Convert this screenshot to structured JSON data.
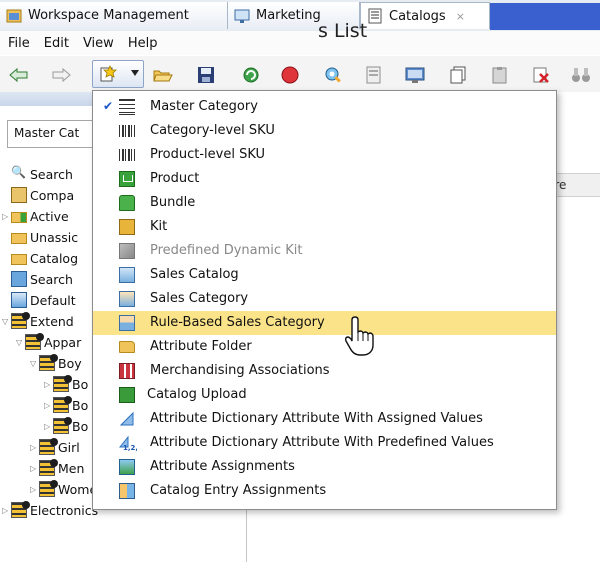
{
  "tabs": [
    {
      "label": "Workspace Management",
      "icon": "workspace-icon",
      "active": false
    },
    {
      "label": "Marketing",
      "icon": "marketing-icon",
      "active": false
    },
    {
      "label": "Catalogs",
      "icon": "catalogs-icon",
      "active": true,
      "close": "⨯"
    }
  ],
  "menubar": [
    "File",
    "Edit",
    "View",
    "Help"
  ],
  "toolbar": {
    "icons": [
      "back-arrow-icon",
      "forward-arrow-icon",
      "new-dropdown-icon",
      "open-folder-icon",
      "save-icon",
      "refresh-icon",
      "stop-icon",
      "find-icon",
      "template-icon",
      "monitor-icon",
      "copy-icon",
      "paste-icon",
      "delete-icon",
      "binoculars-icon"
    ]
  },
  "left_panel": {
    "combo_value": "Master Cat",
    "tree": [
      {
        "label": "Search",
        "icon": "search-icon"
      },
      {
        "label": "Compa",
        "icon": "company-icon"
      },
      {
        "label": "Active",
        "icon": "folder-icon"
      },
      {
        "label": "Unassic",
        "icon": "folder-icon"
      },
      {
        "label": "Catalog",
        "icon": "folder-icon"
      },
      {
        "label": "Search",
        "icon": "search-catalog-icon"
      },
      {
        "label": "Default",
        "icon": "default-icon"
      },
      {
        "label": "Extend",
        "icon": "category-icon"
      },
      {
        "label": "Appar",
        "icon": "category-icon"
      },
      {
        "label": "Boy",
        "icon": "category-icon"
      },
      {
        "label": "Bo",
        "icon": "category-icon"
      },
      {
        "label": "Bo",
        "icon": "category-icon"
      },
      {
        "label": "Bo",
        "icon": "category-icon"
      },
      {
        "label": "Girl",
        "icon": "category-icon"
      },
      {
        "label": "Men",
        "icon": "category-icon"
      },
      {
        "label": "Women",
        "icon": "category-icon"
      },
      {
        "label": "Electronics",
        "icon": "category-icon"
      }
    ]
  },
  "right_panel": {
    "title_fragment": "s List",
    "column_fragment": "ore"
  },
  "new_menu": {
    "items": [
      {
        "label": "Master Category",
        "icon": "master-category-icon",
        "checked": true
      },
      {
        "label": "Category-level SKU",
        "icon": "barcode-icon"
      },
      {
        "label": "Product-level SKU",
        "icon": "barcode-icon"
      },
      {
        "label": "Product",
        "icon": "product-icon"
      },
      {
        "label": "Bundle",
        "icon": "bundle-icon"
      },
      {
        "label": "Kit",
        "icon": "kit-icon"
      },
      {
        "label": "Predefined Dynamic Kit",
        "icon": "dynamic-kit-icon",
        "disabled": true
      },
      {
        "label": "Sales Catalog",
        "icon": "sales-catalog-icon"
      },
      {
        "label": "Sales Category",
        "icon": "sales-category-icon"
      },
      {
        "label": "Rule-Based Sales Category",
        "icon": "rule-based-category-icon",
        "highlighted": true
      },
      {
        "label": "Attribute Folder",
        "icon": "folder-icon"
      },
      {
        "label": "Merchandising Associations",
        "icon": "merchandising-icon"
      },
      {
        "label": "Catalog Upload",
        "icon": "catalog-upload-icon"
      },
      {
        "label": "Attribute Dictionary Attribute With Assigned Values",
        "icon": "attribute-dictionary-icon"
      },
      {
        "label": "Attribute Dictionary Attribute With Predefined Values",
        "icon": "predefined-values-icon"
      },
      {
        "label": "Attribute Assignments",
        "icon": "attribute-assignments-icon"
      },
      {
        "label": "Catalog Entry Assignments",
        "icon": "entry-assignments-icon"
      }
    ]
  },
  "colors": {
    "highlight": "#fbe38a",
    "active_tab_fill": "#3a5fcf",
    "check": "#1b56c9"
  }
}
